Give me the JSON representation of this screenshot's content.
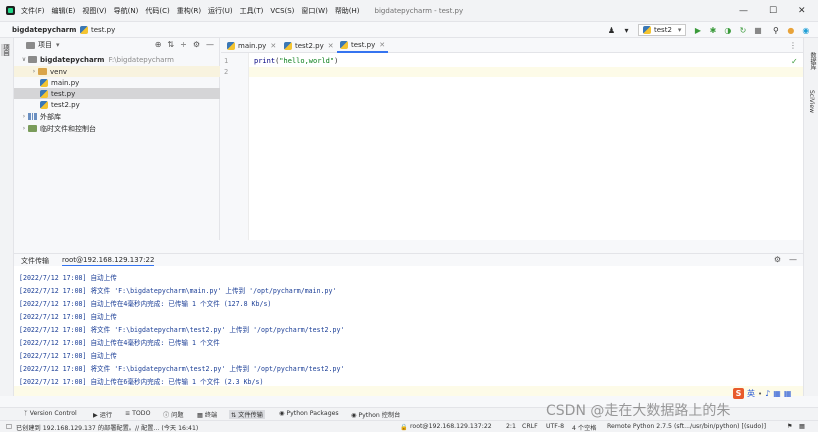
{
  "menubar": {
    "items": [
      "文件(F)",
      "编辑(E)",
      "视图(V)",
      "导航(N)",
      "代码(C)",
      "重构(R)",
      "运行(U)",
      "工具(T)",
      "VCS(S)",
      "窗口(W)",
      "帮助(H)"
    ],
    "window_title": "bigdatepycharm - test.py",
    "minimize": "—",
    "maximize": "☐",
    "close": "✕"
  },
  "navbar": {
    "project": "bigdatepycharm",
    "separator": "›",
    "file": "test.py",
    "run_config": "test2"
  },
  "left_strip": {
    "project_tab": "项目"
  },
  "right_strip": {
    "db_tab": "数据库",
    "sciview_tab": "SciView"
  },
  "project_panel": {
    "title": "项目",
    "root": {
      "name": "bigdatepycharm",
      "path": "F:\\bigdatepycharm"
    },
    "items": [
      {
        "name": "venv",
        "type": "folder"
      },
      {
        "name": "main.py",
        "type": "file"
      },
      {
        "name": "test.py",
        "type": "file",
        "selected": true
      },
      {
        "name": "test2.py",
        "type": "file"
      }
    ],
    "external_libs": "外部库",
    "scratches": "临时文件和控制台"
  },
  "editor": {
    "tabs": [
      {
        "name": "main.py",
        "active": false
      },
      {
        "name": "test2.py",
        "active": false
      },
      {
        "name": "test.py",
        "active": true
      }
    ],
    "line_numbers": [
      "1",
      "2"
    ],
    "code": {
      "func": "print",
      "open": "(",
      "string": "\"hello,world\"",
      "close": ")"
    }
  },
  "tool_window": {
    "tabs": [
      {
        "label": "文件传输",
        "active": false
      },
      {
        "label": "root@192.168.129.137:22",
        "active": true
      }
    ],
    "log_lines": [
      "[2022/7/12 17:08] 自动上传",
      "[2022/7/12 17:08] 将文件 'F:\\bigdatepycharm\\main.py' 上传到 '/opt/pycharm/main.py'",
      "[2022/7/12 17:08] 自动上传在4毫秒内完成: 已传输 1 个文件 (127.8 Kb/s)",
      "[2022/7/12 17:08] 自动上传",
      "[2022/7/12 17:08] 将文件 'F:\\bigdatepycharm\\test2.py' 上传到 '/opt/pycharm/test2.py'",
      "[2022/7/12 17:08] 自动上传在4毫秒内完成: 已传输 1 个文件",
      "[2022/7/12 17:08] 自动上传",
      "[2022/7/12 17:08] 将文件 'F:\\bigdatepycharm\\test2.py' 上传到 '/opt/pycharm/test2.py'",
      "[2022/7/12 17:08] 自动上传在6毫秒内完成: 已传输 1 个文件 (2.3 Kb/s)"
    ]
  },
  "bottom_tabs": [
    "Version Control",
    "运行",
    "TODO",
    "问题",
    "终端",
    "文件传输",
    "Python Packages",
    "Python 控制台"
  ],
  "statusbar": {
    "message": "已创建到 192.168.129.137 的部署配置。// 配置... (今天 16:41)",
    "remote": "root@192.168.129.137:22",
    "position": "2:1",
    "line_sep": "CRLF",
    "encoding": "UTF-8",
    "indent": "4 个空格",
    "interpreter": "Remote Python 2.7.5 (sft.../usr/bin/python) [(sudo)]"
  },
  "ime": {
    "logo": "S",
    "lang": "英"
  },
  "watermark": "CSDN @走在大数据路上的朱",
  "colors": {
    "accent": "#3574f0",
    "log_text": "#1c3f97",
    "string": "#067d17",
    "builtin": "#000080"
  }
}
